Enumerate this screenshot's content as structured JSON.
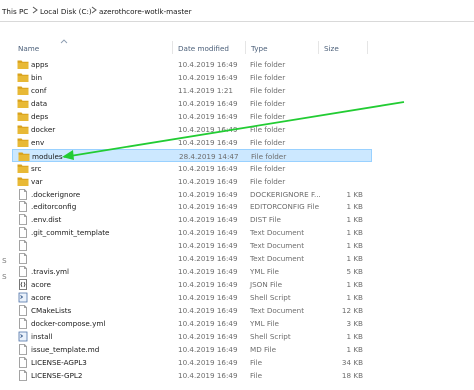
{
  "breadcrumb": [
    "This PC",
    "Local Disk (C:)",
    "azerothcore-wotlk-master"
  ],
  "columns": {
    "name": "Name",
    "date": "Date modified",
    "type": "Type",
    "size": "Size"
  },
  "left_strip": [
    "s",
    "s"
  ],
  "rows": [
    {
      "name": "apps",
      "date": "10.4.2019 16:49",
      "type": "File folder",
      "size": "",
      "icon": "folder-icon"
    },
    {
      "name": "bin",
      "date": "10.4.2019 16:49",
      "type": "File folder",
      "size": "",
      "icon": "folder-icon"
    },
    {
      "name": "conf",
      "date": "11.4.2019 1:21",
      "type": "File folder",
      "size": "",
      "icon": "folder-icon"
    },
    {
      "name": "data",
      "date": "10.4.2019 16:49",
      "type": "File folder",
      "size": "",
      "icon": "folder-icon"
    },
    {
      "name": "deps",
      "date": "10.4.2019 16:49",
      "type": "File folder",
      "size": "",
      "icon": "folder-icon"
    },
    {
      "name": "docker",
      "date": "10.4.2019 16:49",
      "type": "File folder",
      "size": "",
      "icon": "folder-icon"
    },
    {
      "name": "env",
      "date": "10.4.2019 16:49",
      "type": "File folder",
      "size": "",
      "icon": "folder-icon"
    },
    {
      "name": "modules",
      "date": "28.4.2019 14:47",
      "type": "File folder",
      "size": "",
      "icon": "folder-icon",
      "selected": true
    },
    {
      "name": "src",
      "date": "10.4.2019 16:49",
      "type": "File folder",
      "size": "",
      "icon": "folder-icon"
    },
    {
      "name": "var",
      "date": "10.4.2019 16:49",
      "type": "File folder",
      "size": "",
      "icon": "folder-icon"
    },
    {
      "name": ".dockerignore",
      "date": "10.4.2019 16:49",
      "type": "DOCKERIGNORE F...",
      "size": "1 KB",
      "icon": "file-icon"
    },
    {
      "name": ".editorconfig",
      "date": "10.4.2019 16:49",
      "type": "EDITORCONFIG File",
      "size": "1 KB",
      "icon": "file-icon"
    },
    {
      "name": ".env.dist",
      "date": "10.4.2019 16:49",
      "type": "DIST File",
      "size": "1 KB",
      "icon": "file-icon"
    },
    {
      "name": ".git_commit_template",
      "date": "10.4.2019 16:49",
      "type": "Text Document",
      "size": "1 KB",
      "icon": "file-icon"
    },
    {
      "name": "",
      "date": "10.4.2019 16:49",
      "type": "Text Document",
      "size": "1 KB",
      "icon": "file-icon"
    },
    {
      "name": "",
      "date": "10.4.2019 16:49",
      "type": "Text Document",
      "size": "1 KB",
      "icon": "file-icon"
    },
    {
      "name": ".travis.yml",
      "date": "10.4.2019 16:49",
      "type": "YML File",
      "size": "5 KB",
      "icon": "file-icon"
    },
    {
      "name": "acore",
      "date": "10.4.2019 16:49",
      "type": "JSON File",
      "size": "1 KB",
      "icon": "json-icon"
    },
    {
      "name": "acore",
      "date": "10.4.2019 16:49",
      "type": "Shell Script",
      "size": "1 KB",
      "icon": "shell-icon"
    },
    {
      "name": "CMakeLists",
      "date": "10.4.2019 16:49",
      "type": "Text Document",
      "size": "12 KB",
      "icon": "file-icon"
    },
    {
      "name": "docker-compose.yml",
      "date": "10.4.2019 16:49",
      "type": "YML File",
      "size": "3 KB",
      "icon": "file-icon"
    },
    {
      "name": "install",
      "date": "10.4.2019 16:49",
      "type": "Shell Script",
      "size": "1 KB",
      "icon": "shell-icon"
    },
    {
      "name": "issue_template.md",
      "date": "10.4.2019 16:49",
      "type": "MD File",
      "size": "1 KB",
      "icon": "file-icon"
    },
    {
      "name": "LICENSE-AGPL3",
      "date": "10.4.2019 16:49",
      "type": "File",
      "size": "34 KB",
      "icon": "file-icon"
    },
    {
      "name": "LICENSE-GPL2",
      "date": "10.4.2019 16:49",
      "type": "File",
      "size": "18 KB",
      "icon": "file-icon"
    }
  ],
  "colors": {
    "folder": "#e8b936",
    "folder_dark": "#d9a21b",
    "selection": "#cce8ff",
    "selection_border": "#99d1ff",
    "arrow": "#22cc33"
  }
}
